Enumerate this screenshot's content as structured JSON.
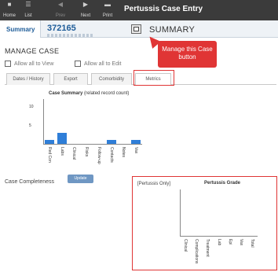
{
  "toolbar": {
    "buttons": [
      {
        "label": "Home",
        "icon": "home-icon"
      },
      {
        "label": "List",
        "icon": "list-icon"
      },
      {
        "label": "Prev",
        "icon": "prev-arrow-icon"
      },
      {
        "label": "Next",
        "icon": "next-arrow-icon"
      },
      {
        "label": "Print",
        "icon": "print-icon"
      }
    ],
    "title": "Pertussis Case Entry"
  },
  "header": {
    "tab_summary": "Summary",
    "case_id": "372165",
    "section_label": "SUMMARY",
    "manage_case_icon": "manage-case-icon"
  },
  "callout": {
    "text": "Manage this Case button",
    "color": "#e03535"
  },
  "manage_case": {
    "title": "MANAGE CASE",
    "allow_view": "Allow all to View",
    "allow_edit": "Allow all to Edit",
    "tabs": [
      "Dates / History",
      "Export",
      "Comorbidity",
      "Metrics"
    ],
    "active_tab": "Metrics"
  },
  "chart_data": [
    {
      "type": "bar",
      "title": "Case Summary",
      "subtitle": "(related record count)",
      "categories": [
        "Red Con",
        "Labs",
        "Clinical",
        "Risks",
        "Follow-up",
        "Contacts",
        "Notes",
        "Vax"
      ],
      "values": [
        1,
        3,
        0,
        0,
        0,
        1,
        0,
        1
      ],
      "ylim": [
        0,
        12
      ],
      "yticks": [
        5,
        10
      ],
      "color": "#2f7ed8"
    },
    {
      "type": "bar",
      "title": "Pertussis Grade",
      "categories": [
        "Clinical",
        "Complications",
        "Treatment",
        "Lab",
        "Epi",
        "Vax",
        "Total"
      ],
      "values": [
        0,
        0,
        0,
        0,
        0,
        0,
        0
      ],
      "color": "#2f7ed8"
    }
  ],
  "completeness": {
    "label": "Case Completeness",
    "update_button": "Update",
    "pertussis_only": "[Pertussis Only]"
  }
}
